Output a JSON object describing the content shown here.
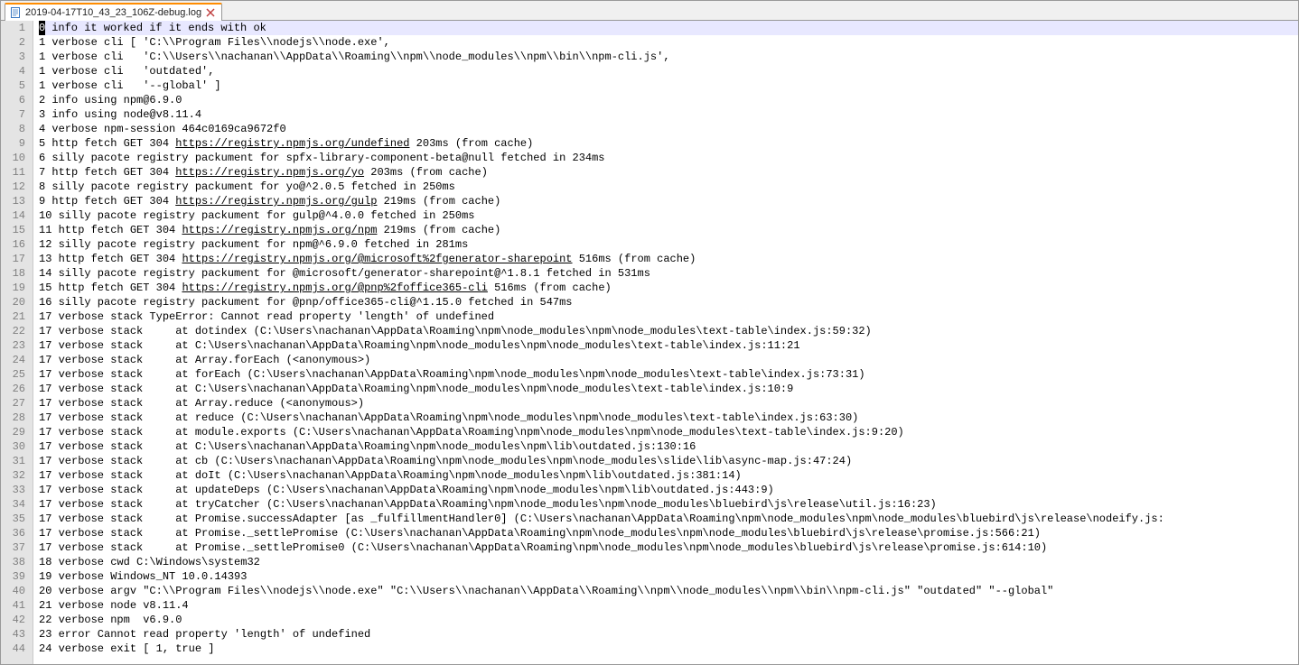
{
  "tab": {
    "title": "2019-04-17T10_43_23_106Z-debug.log",
    "close_glyph": "✕"
  },
  "icons": {
    "file": "file-icon",
    "close": "close-icon"
  },
  "log_file": {
    "line_count": 44,
    "lines": [
      {
        "segments": [
          {
            "text": "0 info it worked if it ends with ok"
          }
        ],
        "first_char_highlight": true
      },
      {
        "segments": [
          {
            "text": "1 verbose cli [ 'C:\\\\Program Files\\\\nodejs\\\\node.exe',"
          }
        ]
      },
      {
        "segments": [
          {
            "text": "1 verbose cli   'C:\\\\Users\\\\nachanan\\\\AppData\\\\Roaming\\\\npm\\\\node_modules\\\\npm\\\\bin\\\\npm-cli.js',"
          }
        ]
      },
      {
        "segments": [
          {
            "text": "1 verbose cli   'outdated',"
          }
        ]
      },
      {
        "segments": [
          {
            "text": "1 verbose cli   '--global' ]"
          }
        ]
      },
      {
        "segments": [
          {
            "text": "2 info using npm@6.9.0"
          }
        ]
      },
      {
        "segments": [
          {
            "text": "3 info using node@v8.11.4"
          }
        ]
      },
      {
        "segments": [
          {
            "text": "4 verbose npm-session 464c0169ca9672f0"
          }
        ]
      },
      {
        "segments": [
          {
            "text": "5 http fetch GET 304 "
          },
          {
            "text": "https://registry.npmjs.org/undefined",
            "url": true
          },
          {
            "text": " 203ms (from cache)"
          }
        ]
      },
      {
        "segments": [
          {
            "text": "6 silly pacote registry packument for spfx-library-component-beta@null fetched in 234ms"
          }
        ]
      },
      {
        "segments": [
          {
            "text": "7 http fetch GET 304 "
          },
          {
            "text": "https://registry.npmjs.org/yo",
            "url": true
          },
          {
            "text": " 203ms (from cache)"
          }
        ]
      },
      {
        "segments": [
          {
            "text": "8 silly pacote registry packument for yo@^2.0.5 fetched in 250ms"
          }
        ]
      },
      {
        "segments": [
          {
            "text": "9 http fetch GET 304 "
          },
          {
            "text": "https://registry.npmjs.org/gulp",
            "url": true
          },
          {
            "text": " 219ms (from cache)"
          }
        ]
      },
      {
        "segments": [
          {
            "text": "10 silly pacote registry packument for gulp@^4.0.0 fetched in 250ms"
          }
        ]
      },
      {
        "segments": [
          {
            "text": "11 http fetch GET 304 "
          },
          {
            "text": "https://registry.npmjs.org/npm",
            "url": true
          },
          {
            "text": " 219ms (from cache)"
          }
        ]
      },
      {
        "segments": [
          {
            "text": "12 silly pacote registry packument for npm@^6.9.0 fetched in 281ms"
          }
        ]
      },
      {
        "segments": [
          {
            "text": "13 http fetch GET 304 "
          },
          {
            "text": "https://registry.npmjs.org/@microsoft%2fgenerator-sharepoint",
            "url": true
          },
          {
            "text": " 516ms (from cache)"
          }
        ]
      },
      {
        "segments": [
          {
            "text": "14 silly pacote registry packument for @microsoft/generator-sharepoint@^1.8.1 fetched in 531ms"
          }
        ]
      },
      {
        "segments": [
          {
            "text": "15 http fetch GET 304 "
          },
          {
            "text": "https://registry.npmjs.org/@pnp%2foffice365-cli",
            "url": true
          },
          {
            "text": " 516ms (from cache)"
          }
        ]
      },
      {
        "segments": [
          {
            "text": "16 silly pacote registry packument for @pnp/office365-cli@^1.15.0 fetched in 547ms"
          }
        ]
      },
      {
        "segments": [
          {
            "text": "17 verbose stack TypeError: Cannot read property 'length' of undefined"
          }
        ]
      },
      {
        "segments": [
          {
            "text": "17 verbose stack     at dotindex (C:\\Users\\nachanan\\AppData\\Roaming\\npm\\node_modules\\npm\\node_modules\\text-table\\index.js:59:32)"
          }
        ]
      },
      {
        "segments": [
          {
            "text": "17 verbose stack     at C:\\Users\\nachanan\\AppData\\Roaming\\npm\\node_modules\\npm\\node_modules\\text-table\\index.js:11:21"
          }
        ]
      },
      {
        "segments": [
          {
            "text": "17 verbose stack     at Array.forEach (<anonymous>)"
          }
        ]
      },
      {
        "segments": [
          {
            "text": "17 verbose stack     at forEach (C:\\Users\\nachanan\\AppData\\Roaming\\npm\\node_modules\\npm\\node_modules\\text-table\\index.js:73:31)"
          }
        ]
      },
      {
        "segments": [
          {
            "text": "17 verbose stack     at C:\\Users\\nachanan\\AppData\\Roaming\\npm\\node_modules\\npm\\node_modules\\text-table\\index.js:10:9"
          }
        ]
      },
      {
        "segments": [
          {
            "text": "17 verbose stack     at Array.reduce (<anonymous>)"
          }
        ]
      },
      {
        "segments": [
          {
            "text": "17 verbose stack     at reduce (C:\\Users\\nachanan\\AppData\\Roaming\\npm\\node_modules\\npm\\node_modules\\text-table\\index.js:63:30)"
          }
        ]
      },
      {
        "segments": [
          {
            "text": "17 verbose stack     at module.exports (C:\\Users\\nachanan\\AppData\\Roaming\\npm\\node_modules\\npm\\node_modules\\text-table\\index.js:9:20)"
          }
        ]
      },
      {
        "segments": [
          {
            "text": "17 verbose stack     at C:\\Users\\nachanan\\AppData\\Roaming\\npm\\node_modules\\npm\\lib\\outdated.js:130:16"
          }
        ]
      },
      {
        "segments": [
          {
            "text": "17 verbose stack     at cb (C:\\Users\\nachanan\\AppData\\Roaming\\npm\\node_modules\\npm\\node_modules\\slide\\lib\\async-map.js:47:24)"
          }
        ]
      },
      {
        "segments": [
          {
            "text": "17 verbose stack     at doIt (C:\\Users\\nachanan\\AppData\\Roaming\\npm\\node_modules\\npm\\lib\\outdated.js:381:14)"
          }
        ]
      },
      {
        "segments": [
          {
            "text": "17 verbose stack     at updateDeps (C:\\Users\\nachanan\\AppData\\Roaming\\npm\\node_modules\\npm\\lib\\outdated.js:443:9)"
          }
        ]
      },
      {
        "segments": [
          {
            "text": "17 verbose stack     at tryCatcher (C:\\Users\\nachanan\\AppData\\Roaming\\npm\\node_modules\\npm\\node_modules\\bluebird\\js\\release\\util.js:16:23)"
          }
        ]
      },
      {
        "segments": [
          {
            "text": "17 verbose stack     at Promise.successAdapter [as _fulfillmentHandler0] (C:\\Users\\nachanan\\AppData\\Roaming\\npm\\node_modules\\npm\\node_modules\\bluebird\\js\\release\\nodeify.js:"
          }
        ]
      },
      {
        "segments": [
          {
            "text": "17 verbose stack     at Promise._settlePromise (C:\\Users\\nachanan\\AppData\\Roaming\\npm\\node_modules\\npm\\node_modules\\bluebird\\js\\release\\promise.js:566:21)"
          }
        ]
      },
      {
        "segments": [
          {
            "text": "17 verbose stack     at Promise._settlePromise0 (C:\\Users\\nachanan\\AppData\\Roaming\\npm\\node_modules\\npm\\node_modules\\bluebird\\js\\release\\promise.js:614:10)"
          }
        ]
      },
      {
        "segments": [
          {
            "text": "18 verbose cwd C:\\Windows\\system32"
          }
        ]
      },
      {
        "segments": [
          {
            "text": "19 verbose Windows_NT 10.0.14393"
          }
        ]
      },
      {
        "segments": [
          {
            "text": "20 verbose argv \"C:\\\\Program Files\\\\nodejs\\\\node.exe\" \"C:\\\\Users\\\\nachanan\\\\AppData\\\\Roaming\\\\npm\\\\node_modules\\\\npm\\\\bin\\\\npm-cli.js\" \"outdated\" \"--global\""
          }
        ]
      },
      {
        "segments": [
          {
            "text": "21 verbose node v8.11.4"
          }
        ]
      },
      {
        "segments": [
          {
            "text": "22 verbose npm  v6.9.0"
          }
        ]
      },
      {
        "segments": [
          {
            "text": "23 error Cannot read property 'length' of undefined"
          }
        ]
      },
      {
        "segments": [
          {
            "text": "24 verbose exit [ 1, true ]"
          }
        ]
      }
    ]
  }
}
